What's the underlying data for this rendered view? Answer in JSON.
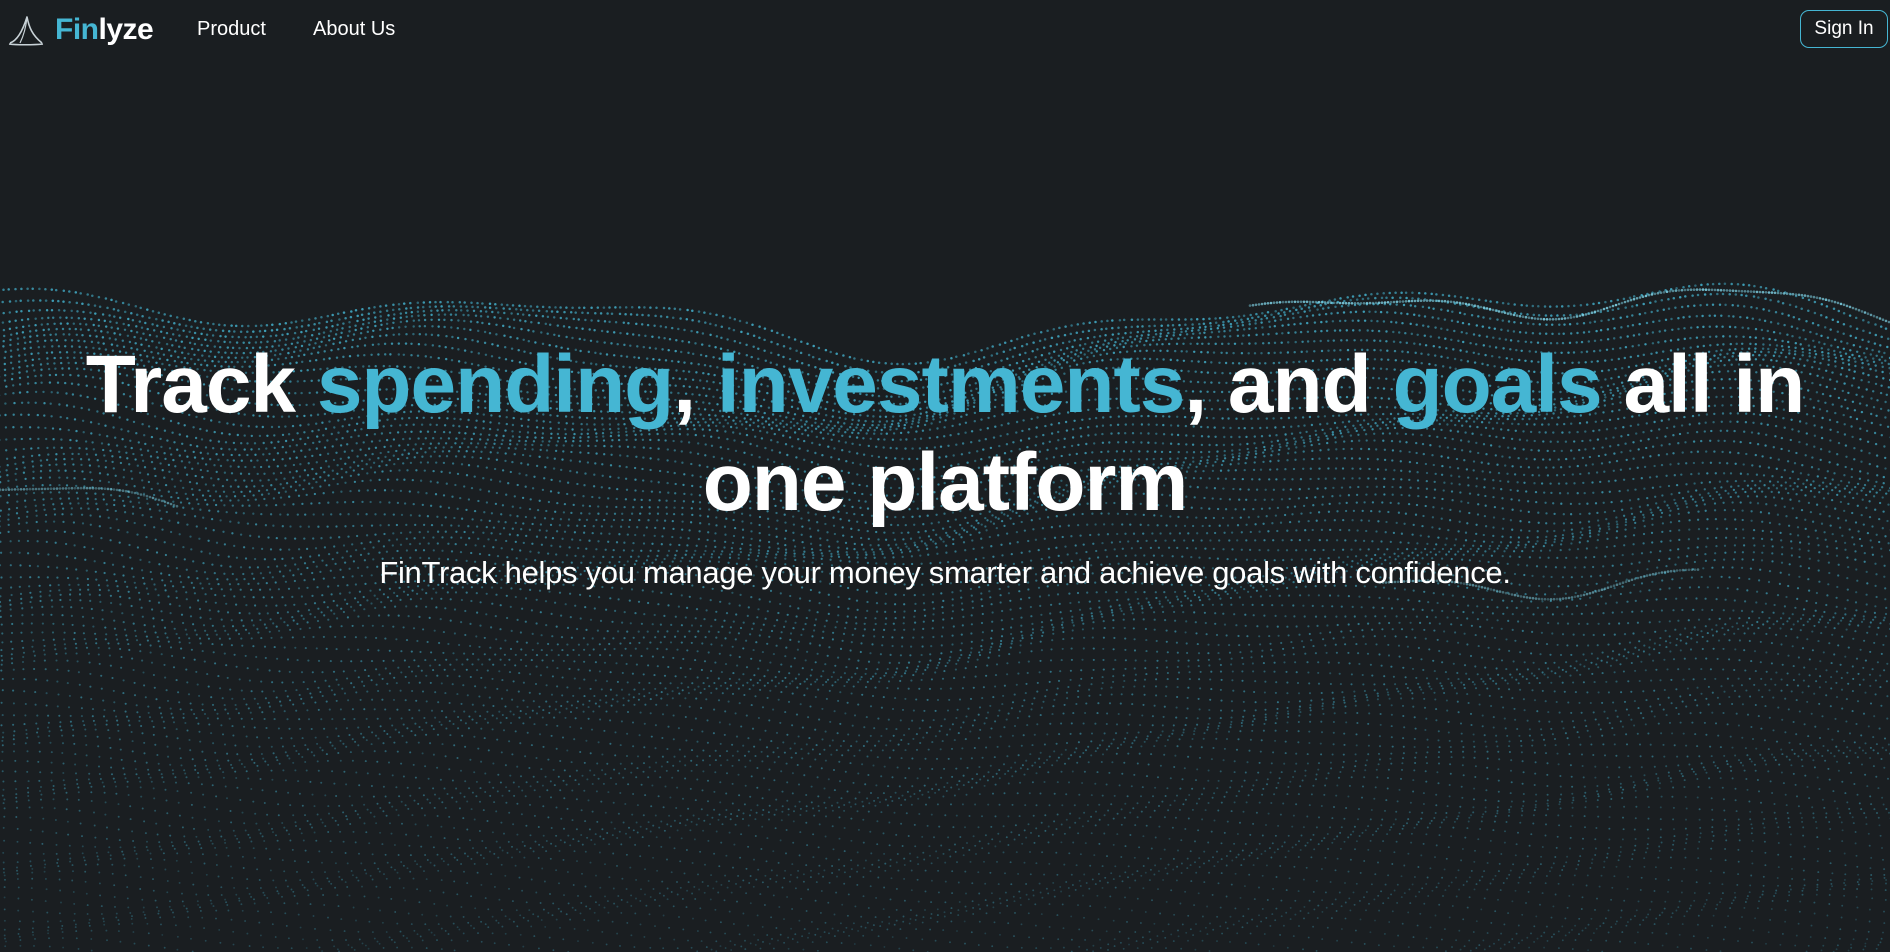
{
  "nav": {
    "brand_prefix": "Fin",
    "brand_suffix": "lyze",
    "links": [
      "Product",
      "About Us"
    ],
    "sign_in_label": "Sign In"
  },
  "hero": {
    "headline": {
      "t1": "Track ",
      "w1": "spending",
      "t2": ", ",
      "w2": "investments",
      "t3": ", and ",
      "w3": "goals",
      "t4": " all in one platform"
    },
    "subtitle": "FinTrack helps you manage your money smarter and achieve goals with confidence."
  },
  "theme": {
    "background": "#1a1e21",
    "accent": "#45b6d3",
    "text": "#ffffff"
  },
  "icons": {
    "logo": "shark-fin-icon"
  }
}
